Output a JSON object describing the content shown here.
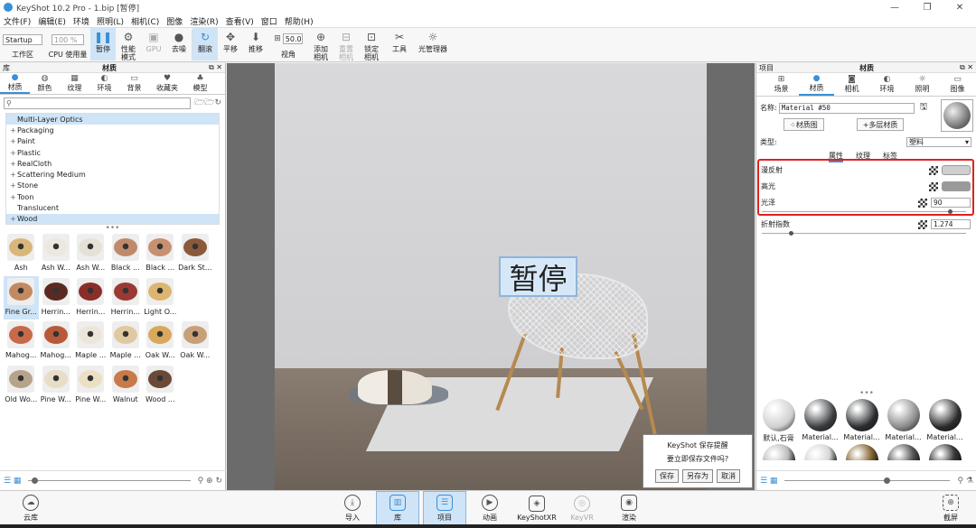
{
  "window": {
    "title": "KeyShot 10.2 Pro - 1.bip [暂停]",
    "controls": [
      "—",
      "❐",
      "✕"
    ]
  },
  "menu": [
    "文件(F)",
    "编辑(E)",
    "环境",
    "照明(L)",
    "相机(C)",
    "图像",
    "渲染(R)",
    "查看(V)",
    "窗口",
    "帮助(H)"
  ],
  "toolbar": {
    "workspace_value": "Startup",
    "workspace_label": "工作区",
    "cpu_value": "100 %",
    "cpu_label": "CPU 使用量",
    "pause": "暂停",
    "performance": "性能\n模式",
    "gpu": "GPU",
    "denoise": "去噪",
    "refresh": "翻滚",
    "pan": "平移",
    "push": "推移",
    "fov_value": "50.0",
    "fov_label": "视角",
    "add_camera": "添加\n相机",
    "reset_camera": "重置\n相机",
    "lock_camera": "锁定\n相机",
    "tools": "工具",
    "light_manager": "光管理器"
  },
  "library": {
    "header": "库",
    "title": "材质",
    "tabs": [
      "材质",
      "颜色",
      "纹理",
      "环境",
      "背景",
      "收藏夹",
      "模型"
    ],
    "tree": [
      {
        "label": "Multi-Layer Optics",
        "expand": "",
        "highlight": true
      },
      {
        "label": "Packaging",
        "expand": "+",
        "highlight": false
      },
      {
        "label": "Paint",
        "expand": "+",
        "highlight": false
      },
      {
        "label": "Plastic",
        "expand": "+",
        "highlight": false
      },
      {
        "label": "RealCloth",
        "expand": "+",
        "highlight": false
      },
      {
        "label": "Scattering Medium",
        "expand": "+",
        "highlight": false
      },
      {
        "label": "Stone",
        "expand": "+",
        "highlight": false
      },
      {
        "label": "Toon",
        "expand": "+",
        "highlight": false
      },
      {
        "label": "Translucent",
        "expand": "",
        "highlight": false
      },
      {
        "label": "Wood",
        "expand": "+",
        "highlight": true
      }
    ],
    "swatches": [
      {
        "name": "Ash",
        "color": "#d9b77a",
        "selected": false
      },
      {
        "name": "Ash W...",
        "color": "#ece8e0",
        "selected": false
      },
      {
        "name": "Ash W...",
        "color": "#e6e1d6",
        "selected": false
      },
      {
        "name": "Black ...",
        "color": "#c08a6a",
        "selected": false
      },
      {
        "name": "Black ...",
        "color": "#c79070",
        "selected": false
      },
      {
        "name": "Dark St...",
        "color": "#8a5a3a",
        "selected": false
      },
      {
        "name": "Fine Gr...",
        "color": "#c28a62",
        "selected": true
      },
      {
        "name": "Herrin...",
        "color": "#5a2a22",
        "selected": false
      },
      {
        "name": "Herrin...",
        "color": "#8a2e2a",
        "selected": false
      },
      {
        "name": "Herrin...",
        "color": "#9a3a34",
        "selected": false
      },
      {
        "name": "Light O...",
        "color": "#dcb670",
        "selected": false
      },
      {
        "name": "",
        "color": "",
        "selected": false
      },
      {
        "name": "Mahog...",
        "color": "#c86a4a",
        "selected": false
      },
      {
        "name": "Mahog...",
        "color": "#b85a3a",
        "selected": false
      },
      {
        "name": "Maple ...",
        "color": "#ece6da",
        "selected": false
      },
      {
        "name": "Maple ...",
        "color": "#e0c9a0",
        "selected": false
      },
      {
        "name": "Oak W...",
        "color": "#d9a85a",
        "selected": false
      },
      {
        "name": "Oak W...",
        "color": "#c8a078",
        "selected": false
      },
      {
        "name": "Old Wo...",
        "color": "#b6a48a",
        "selected": false
      },
      {
        "name": "Pine W...",
        "color": "#e8ddc6",
        "selected": false
      },
      {
        "name": "Pine W...",
        "color": "#ece0c4",
        "selected": false
      },
      {
        "name": "Walnut",
        "color": "#c87a4a",
        "selected": false
      },
      {
        "name": "Wood ...",
        "color": "#6a4a36",
        "selected": false
      }
    ]
  },
  "viewport": {
    "pause_label": "暂停",
    "dialog": {
      "title": "KeyShot 保存提醒",
      "message": "要立即保存文件吗?",
      "save": "保存",
      "save_as": "另存为",
      "cancel": "取消"
    }
  },
  "project": {
    "header": "项目",
    "title": "材质",
    "tabs": [
      "场景",
      "材质",
      "相机",
      "环境",
      "照明",
      "图像"
    ],
    "name_label": "名称:",
    "name_value": "Material #50",
    "material_graph": "材质图",
    "multilayer": "多层材质",
    "type_label": "类型:",
    "type_value": "塑料",
    "subtabs": [
      "属性",
      "纹理",
      "标签"
    ],
    "diffuse_label": "漫反射",
    "diffuse_color": "#cfcfcf",
    "specular_label": "高光",
    "specular_color": "#9a9a9a",
    "gloss_label": "光泽",
    "gloss_value": "90",
    "ior_label": "折射指数",
    "ior_value": "1.274",
    "materials": [
      {
        "name": "默认,石膏",
        "color": "#cfcfcf"
      },
      {
        "name": "Material...",
        "color": "#3a3d40"
      },
      {
        "name": "Material...",
        "color": "#2a2d30"
      },
      {
        "name": "Material...",
        "color": "#8a8a8a"
      },
      {
        "name": "Material...",
        "color": "#2a2a2a"
      }
    ],
    "materials_row2": [
      "#bcbcbc",
      "#d6d6d6",
      "#8a6a3a",
      "#5a5a5a",
      "#3a3a3a"
    ]
  },
  "bottom": {
    "cloud": "云库",
    "import": "导入",
    "library": "库",
    "project": "项目",
    "animation": "动画",
    "keyshotxr": "KeyShotXR",
    "keyvr": "KeyVR",
    "render": "渲染",
    "screenshot": "截屏"
  }
}
